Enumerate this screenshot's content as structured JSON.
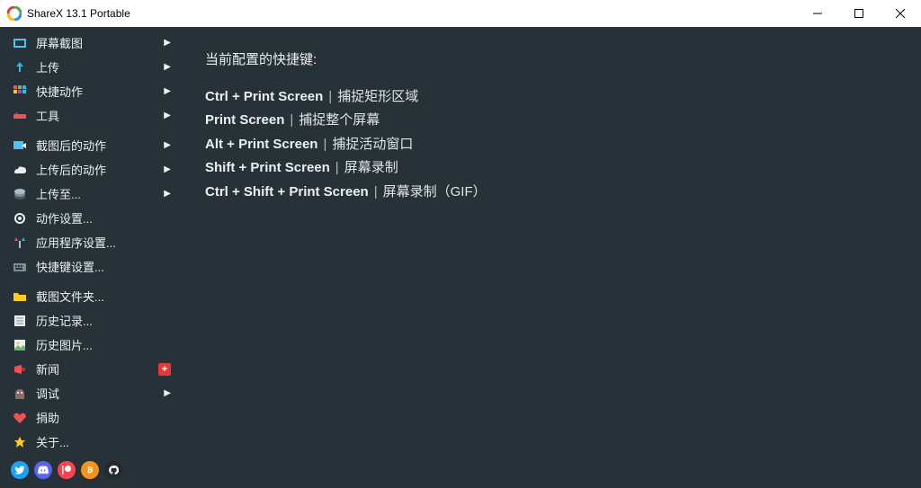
{
  "window": {
    "title": "ShareX 13.1 Portable"
  },
  "sidebar": {
    "groups": [
      [
        {
          "icon": "capture",
          "label": "屏幕截图",
          "arrow": true
        },
        {
          "icon": "upload",
          "label": "上传",
          "arrow": true
        },
        {
          "icon": "quick",
          "label": "快捷动作",
          "arrow": true
        },
        {
          "icon": "tools",
          "label": "工具",
          "arrow": true
        }
      ],
      [
        {
          "icon": "after-capture",
          "label": "截图后的动作",
          "arrow": true
        },
        {
          "icon": "after-upload",
          "label": "上传后的动作",
          "arrow": true
        },
        {
          "icon": "destinations",
          "label": "上传至...",
          "arrow": true
        },
        {
          "icon": "task-settings",
          "label": "动作设置..."
        },
        {
          "icon": "app-settings",
          "label": "应用程序设置..."
        },
        {
          "icon": "hotkey-settings",
          "label": "快捷键设置..."
        }
      ],
      [
        {
          "icon": "folder",
          "label": "截图文件夹..."
        },
        {
          "icon": "history",
          "label": "历史记录..."
        },
        {
          "icon": "image-history",
          "label": "历史图片..."
        },
        {
          "icon": "news",
          "label": "新闻",
          "badge": "+"
        },
        {
          "icon": "debug",
          "label": "调试",
          "arrow": true
        },
        {
          "icon": "donate",
          "label": "捐助"
        },
        {
          "icon": "about",
          "label": "关于..."
        }
      ]
    ]
  },
  "social": {
    "items": [
      {
        "name": "twitter",
        "bg": "#1da1f2"
      },
      {
        "name": "discord",
        "bg": "#5865f2"
      },
      {
        "name": "patreon",
        "bg": "#ff424d"
      },
      {
        "name": "bitcoin",
        "bg": "#f7931a"
      },
      {
        "name": "github",
        "bg": "#24292e"
      }
    ]
  },
  "main": {
    "heading": "当前配置的快捷键:",
    "hotkeys": [
      {
        "keys": "Ctrl + Print Screen",
        "action": "捕捉矩形区域"
      },
      {
        "keys": "Print Screen",
        "action": "捕捉整个屏幕"
      },
      {
        "keys": "Alt + Print Screen",
        "action": "捕捉活动窗口"
      },
      {
        "keys": "Shift + Print Screen",
        "action": "屏幕录制"
      },
      {
        "keys": "Ctrl + Shift + Print Screen",
        "action": "屏幕录制（GIF）"
      }
    ]
  }
}
